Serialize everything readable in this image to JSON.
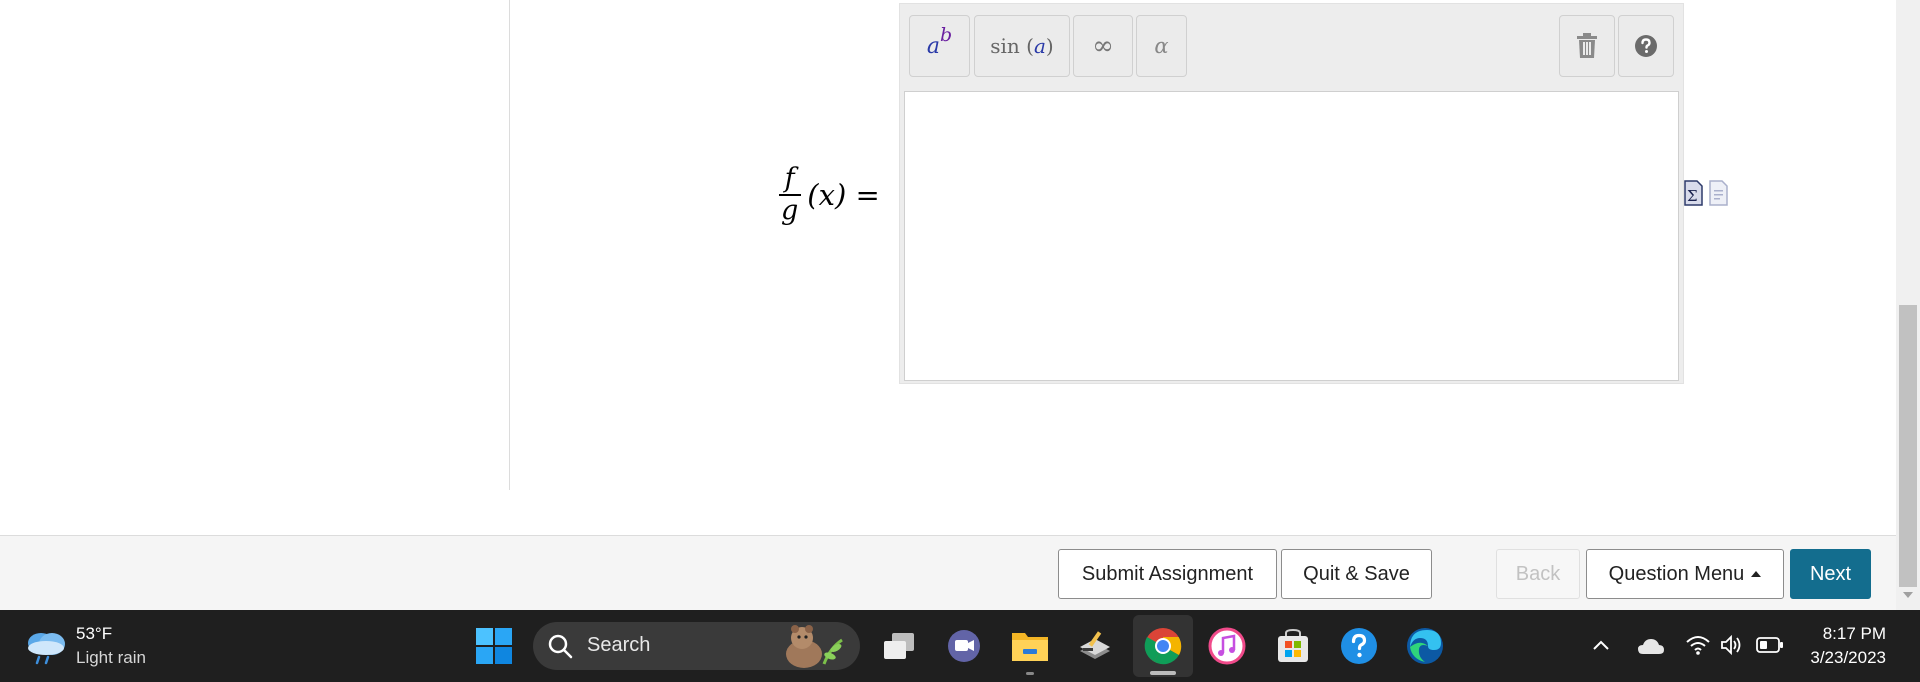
{
  "question": {
    "lhs_numerator": "f",
    "lhs_denominator": "g",
    "lhs_argument": "(x) ="
  },
  "toolbar": {
    "power_base": "a",
    "power_exp": "b",
    "sin_label": "sin",
    "sin_arg": "a",
    "infinity": "∞",
    "alpha": "α"
  },
  "footer": {
    "submit_label": "Submit Assignment",
    "quit_label": "Quit & Save",
    "back_label": "Back",
    "question_menu_label": "Question Menu",
    "next_label": "Next"
  },
  "taskbar": {
    "weather_temp": "53°F",
    "weather_desc": "Light rain",
    "search_label": "Search",
    "time": "8:17 PM",
    "date": "3/23/2023"
  },
  "colors": {
    "next_button": "#136d8e",
    "taskbar": "#1f1f1f"
  }
}
